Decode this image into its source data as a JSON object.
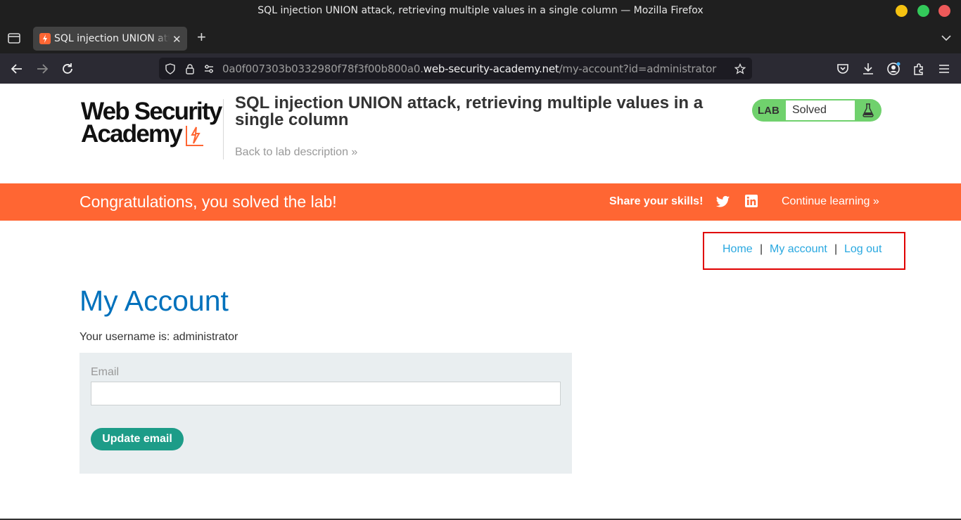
{
  "window": {
    "title": "SQL injection UNION attack, retrieving multiple values in a single column — Mozilla Firefox"
  },
  "browser": {
    "tab_title": "SQL injection UNION attack, retrieving multiple values in a single column",
    "tab_close": "✕",
    "new_tab": "+",
    "url_prefix": "0a0f007303b0332980f78f3f00b800a0.",
    "url_host": "web-security-academy.net",
    "url_path": "/my-account?id=administrator"
  },
  "header": {
    "logo_line1": "Web Security",
    "logo_line2": "Academy",
    "lab_title": "SQL injection UNION attack, retrieving multiple values in a single column",
    "back_link": "Back to lab description »",
    "lab_badge_label": "LAB",
    "lab_status": "Solved",
    "badge_color": "#70d16d"
  },
  "banner": {
    "message": "Congratulations, you solved the lab!",
    "share_label": "Share your skills!",
    "continue_label": "Continue learning »",
    "color": "#ff6633"
  },
  "nav": {
    "home": "Home",
    "separator": "|",
    "my_account": "My account",
    "log_out": "Log out"
  },
  "main": {
    "heading": "My Account",
    "username_line": "Your username is: administrator",
    "email_label": "Email",
    "email_value": "",
    "update_button": "Update email",
    "accent_color": "#1d9c88"
  }
}
